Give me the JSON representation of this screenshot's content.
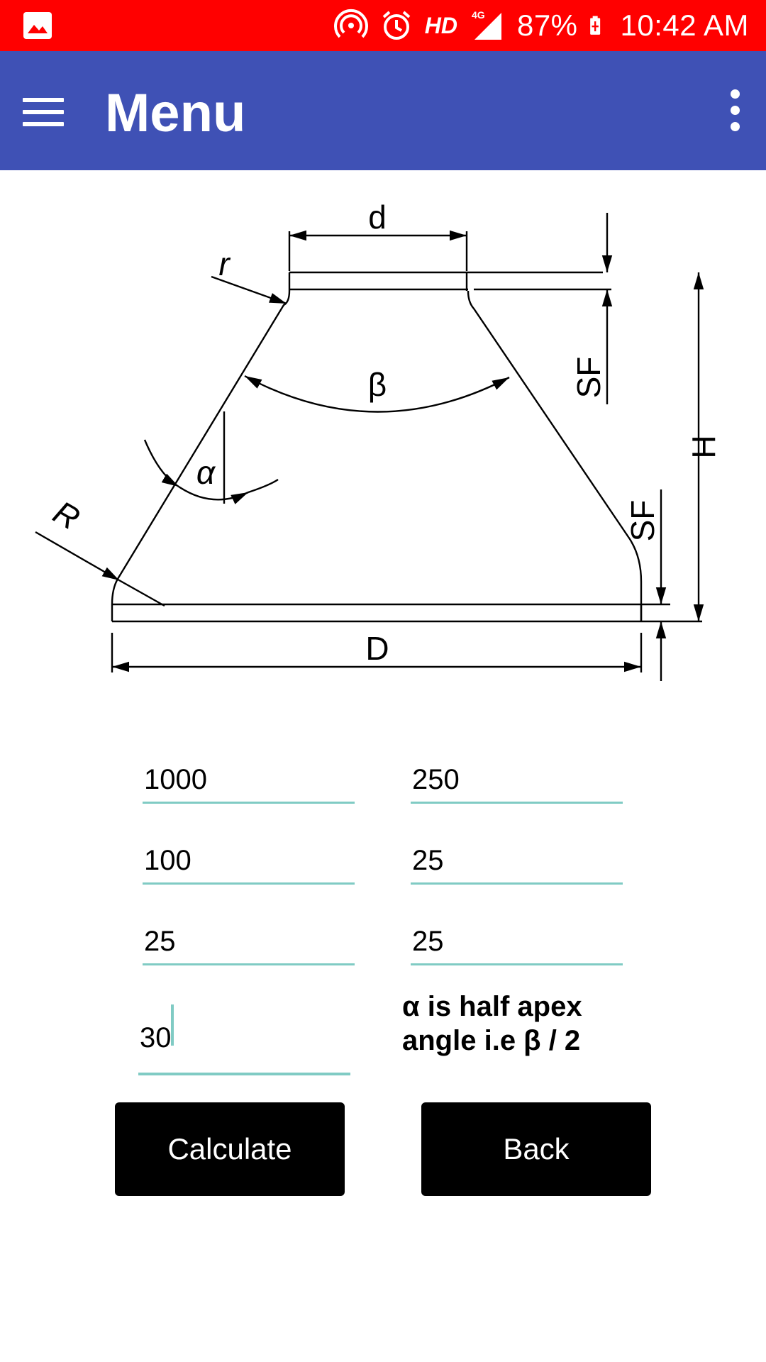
{
  "status_bar": {
    "hd_label": "HD",
    "network_label": "4G",
    "battery": "87%",
    "time": "10:42 AM",
    "icons": [
      "image-icon",
      "hotspot-icon",
      "alarm-icon",
      "signal-icon",
      "battery-charging-icon"
    ]
  },
  "app_bar": {
    "title": "Menu",
    "icons": [
      "hamburger-menu-icon",
      "overflow-menu-icon"
    ]
  },
  "diagram": {
    "labels": {
      "d": "d",
      "r": "r",
      "beta": "β",
      "alpha": "α",
      "R": "R",
      "D": "D",
      "SF_top": "SF",
      "SF_bottom": "SF",
      "H": "H"
    }
  },
  "form": {
    "inputs": [
      {
        "value": "1000"
      },
      {
        "value": "250"
      },
      {
        "value": "100"
      },
      {
        "value": "25"
      },
      {
        "value": "25"
      },
      {
        "value": "25"
      },
      {
        "value": "30"
      }
    ],
    "note_line1": "α is half apex",
    "note_line2": "angle i.e β / 2"
  },
  "buttons": {
    "calculate": "Calculate",
    "back": "Back"
  },
  "colors": {
    "status_bar": "#ff0000",
    "app_bar": "#3f51b5",
    "input_underline": "#80cbc4",
    "button_bg": "#000000",
    "button_text": "#ffffff"
  }
}
